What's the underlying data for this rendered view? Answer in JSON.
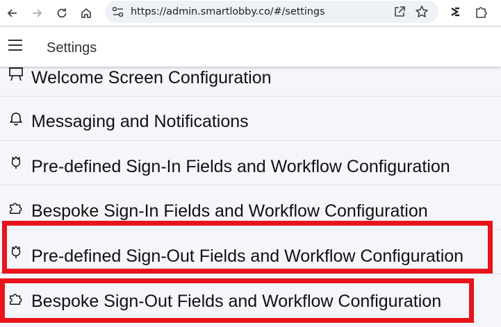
{
  "browser": {
    "url": "https://admin.smartlobby.co/#/settings"
  },
  "appbar": {
    "title": "Settings"
  },
  "settings": {
    "items": [
      {
        "label": "Welcome Screen Configuration",
        "icon": "presentation-board-icon"
      },
      {
        "label": "Messaging and Notifications",
        "icon": "bell-icon"
      },
      {
        "label": "Pre-defined Sign-In Fields and Workflow Configuration",
        "icon": "flower-icon"
      },
      {
        "label": "Bespoke Sign-In Fields and Workflow Configuration",
        "icon": "puzzle-icon"
      },
      {
        "label": "Pre-defined Sign-Out Fields and Workflow Configuration",
        "icon": "flower-icon"
      },
      {
        "label": "Bespoke Sign-Out Fields and Workflow Configuration",
        "icon": "puzzle-icon"
      }
    ]
  },
  "colors": {
    "highlight": "#e8141a",
    "list_background": "#f4f6fb"
  }
}
